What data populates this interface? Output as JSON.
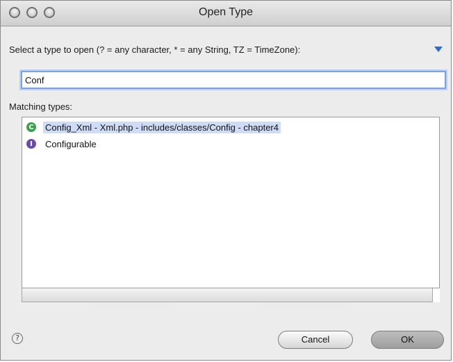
{
  "window": {
    "title": "Open Type"
  },
  "prompt": {
    "text": "Select a type to open (? = any character, * = any String, TZ = TimeZone):",
    "menu_icon": "triangle-down-icon"
  },
  "search": {
    "value": "Conf"
  },
  "matches": {
    "label": "Matching types:",
    "items": [
      {
        "icon": "class-icon",
        "glyph": "C",
        "label": "Config_Xml - Xml.php - includes/classes/Config - chapter4",
        "selected": true
      },
      {
        "icon": "interface-icon",
        "glyph": "I",
        "label": "Configurable",
        "selected": false
      }
    ]
  },
  "buttons": {
    "help": "?",
    "cancel": "Cancel",
    "ok": "OK"
  },
  "colors": {
    "selection": "#cfdcf7",
    "class_icon": "#3aa24a",
    "interface_icon": "#6a4bb5",
    "accent": "#2f6ad6"
  }
}
